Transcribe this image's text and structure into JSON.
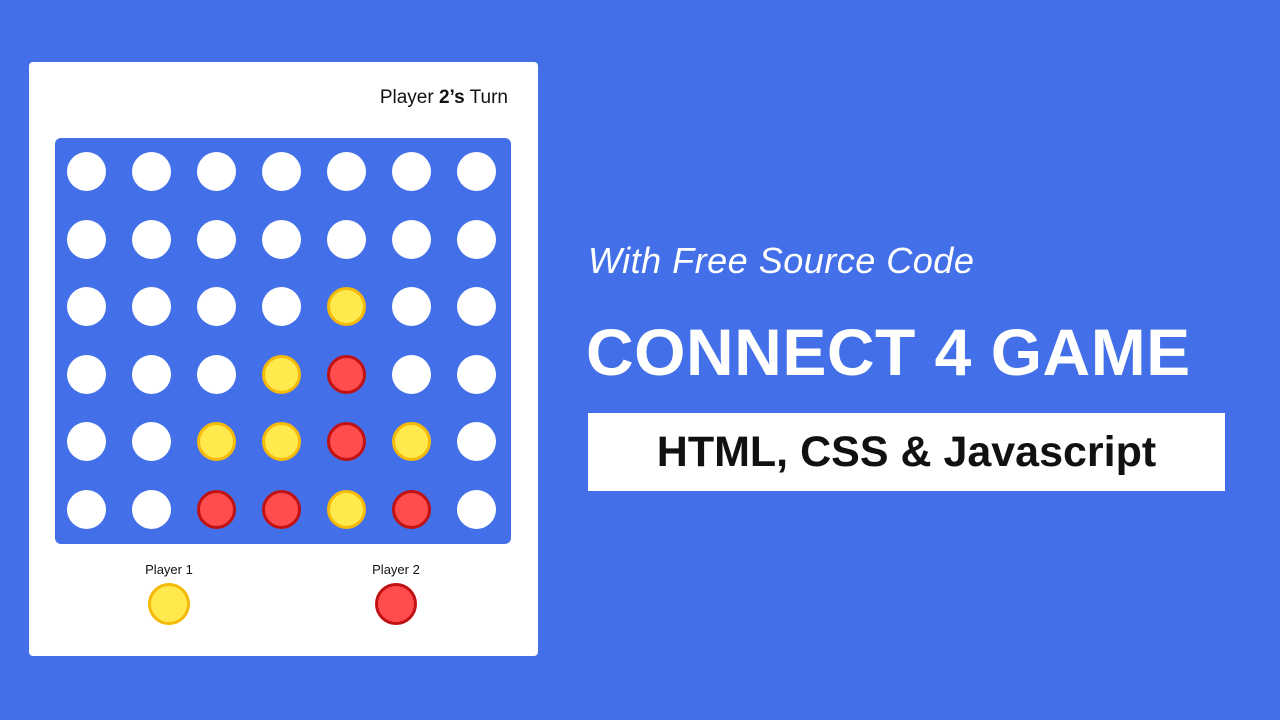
{
  "game": {
    "turn_prefix": "Player ",
    "turn_player": "2’s",
    "turn_suffix": " Turn",
    "board": [
      [
        "empty",
        "empty",
        "empty",
        "empty",
        "empty",
        "empty",
        "empty"
      ],
      [
        "empty",
        "empty",
        "empty",
        "empty",
        "empty",
        "empty",
        "empty"
      ],
      [
        "empty",
        "empty",
        "empty",
        "empty",
        "yellow",
        "empty",
        "empty"
      ],
      [
        "empty",
        "empty",
        "empty",
        "yellow",
        "red",
        "empty",
        "empty"
      ],
      [
        "empty",
        "empty",
        "yellow",
        "yellow",
        "red",
        "yellow",
        "empty"
      ],
      [
        "empty",
        "empty",
        "red",
        "red",
        "yellow",
        "red",
        "empty"
      ]
    ],
    "players": [
      {
        "label": "Player 1",
        "color": "yellow"
      },
      {
        "label": "Player 2",
        "color": "red"
      }
    ]
  },
  "promo": {
    "tagline": "With Free Source Code",
    "headline": "CONNECT 4 GAME",
    "tech": "HTML, CSS & Javascript"
  },
  "colors": {
    "background": "#4370e8",
    "yellow_disc": "#ffe94c",
    "red_disc": "#ff4d4d"
  }
}
